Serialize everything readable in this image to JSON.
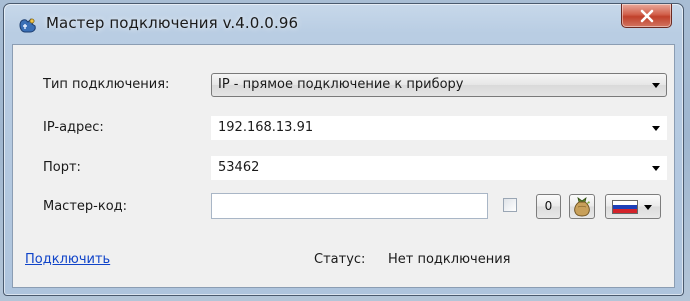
{
  "window": {
    "title": "Мастер подключения v.4.0.0.96",
    "app_icon": "hand-key-icon",
    "close_icon": "close-icon"
  },
  "form": {
    "connection_type": {
      "label": "Тип подключения:",
      "value": "IP - прямое подключение к прибору"
    },
    "ip_address": {
      "label": "IP-адрес:",
      "value": "192.168.13.91"
    },
    "port": {
      "label": "Порт:",
      "value": "53462"
    },
    "master_code": {
      "label": "Мастер-код:",
      "value": "",
      "show_checkbox_checked": false,
      "zero_button_label": "0",
      "bag_icon": "money-bag-icon",
      "language_flag": "russian-flag-icon"
    }
  },
  "footer": {
    "connect_link": "Подключить",
    "status_label": "Статус:",
    "status_value": "Нет подключения"
  },
  "colors": {
    "link": "#1044c9",
    "close_button": "#c7462f"
  }
}
